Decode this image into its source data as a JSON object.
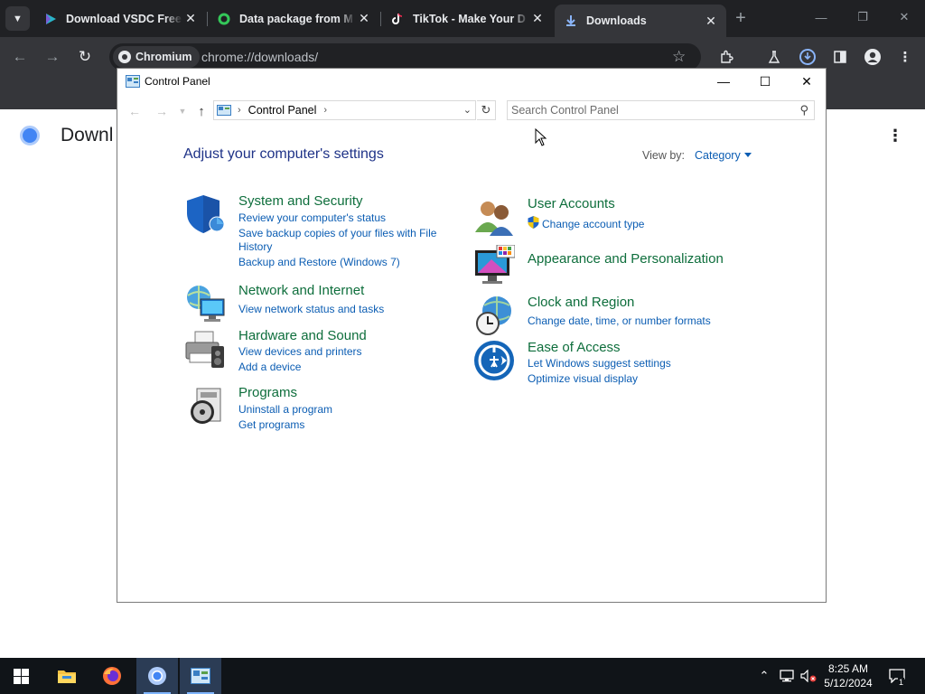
{
  "browser": {
    "tabs": [
      {
        "title": "Download VSDC Free",
        "favicon": "vsdc-play-icon"
      },
      {
        "title": "Data package from M",
        "favicon": "green-ring-icon"
      },
      {
        "title": "TikTok - Make Your D",
        "favicon": "tiktok-icon"
      },
      {
        "title": "Downloads",
        "favicon": "download-arrow-icon",
        "active": true
      }
    ],
    "site_chip": "Chromium",
    "url": "chrome://downloads/",
    "page_title": "Downl"
  },
  "control_panel": {
    "window_title": "Control Panel",
    "breadcrumb": "Control Panel",
    "search_placeholder": "Search Control Panel",
    "heading": "Adjust your computer's settings",
    "view_by_label": "View by:",
    "view_by_value": "Category",
    "categories": [
      {
        "title": "System and Security",
        "icon": "shield-icon",
        "links": [
          "Review your computer's status",
          "Save backup copies of your files with File",
          "History",
          "Backup and Restore (Windows 7)"
        ]
      },
      {
        "title": "Network and Internet",
        "icon": "network-globe-icon",
        "links": [
          "View network status and tasks"
        ]
      },
      {
        "title": "Hardware and Sound",
        "icon": "printer-icon",
        "links": [
          "View devices and printers",
          "Add a device"
        ]
      },
      {
        "title": "Programs",
        "icon": "programs-disc-icon",
        "links": [
          "Uninstall a program",
          "Get programs"
        ]
      },
      {
        "title": "User Accounts",
        "icon": "users-icon",
        "links": [
          "Change account type"
        ]
      },
      {
        "title": "Appearance and Personalization",
        "icon": "monitor-palette-icon",
        "links": []
      },
      {
        "title": "Clock and Region",
        "icon": "clock-globe-icon",
        "links": [
          "Change date, time, or number formats"
        ]
      },
      {
        "title": "Ease of Access",
        "icon": "ease-of-access-icon",
        "links": [
          "Let Windows suggest settings",
          "Optimize visual display"
        ]
      }
    ]
  },
  "taskbar": {
    "time": "8:25 AM",
    "date": "5/12/2024",
    "notification_count": "1"
  }
}
